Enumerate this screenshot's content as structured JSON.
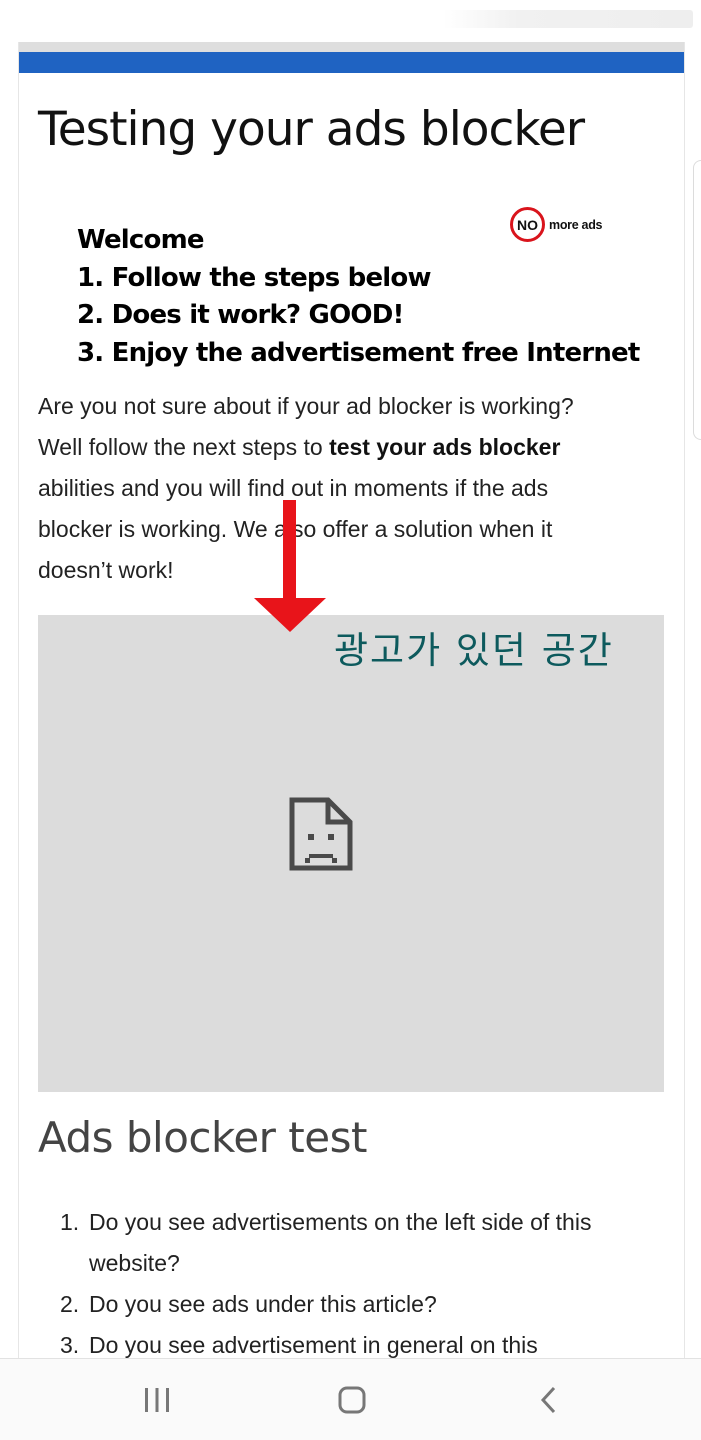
{
  "header": {
    "accent_color": "#1f63c2"
  },
  "article": {
    "title": "Testing your ads blocker",
    "banner": {
      "lines": [
        "Welcome",
        "1. Follow the steps below",
        "2. Does it work? GOOD!",
        "3. Enjoy the advertisement free Internet"
      ],
      "logo_no": "NO",
      "logo_text": "more ads"
    },
    "intro": {
      "line1": "Are you not sure about if your ad blocker is working?",
      "line2_pre": "Well follow the next steps to ",
      "line2_bold": "test your ads blocker",
      "line3": "abilities and you will find out in moments if the ads",
      "line4": "blocker is working. We also offer a solution when it",
      "line5": "doesn’t work!"
    },
    "ad_placeholder": {
      "annotation": "광고가 있던 공간",
      "icon": "broken-page-icon",
      "annotation_color": "#0d5a5d",
      "arrow_color": "#e8141a"
    },
    "section_title": "Ads blocker test",
    "steps": [
      {
        "num": "1.",
        "line1": "Do you see advertisements on the left side of this",
        "line2": "website?"
      },
      {
        "num": "2.",
        "line1": "Do you see ads under this article?",
        "line2": ""
      },
      {
        "num": "3.",
        "line1": "Do you see advertisement in general on this",
        "line2": ""
      }
    ]
  },
  "navigation": {
    "recents": "recent-apps-icon",
    "home": "home-icon",
    "back": "back-icon"
  }
}
